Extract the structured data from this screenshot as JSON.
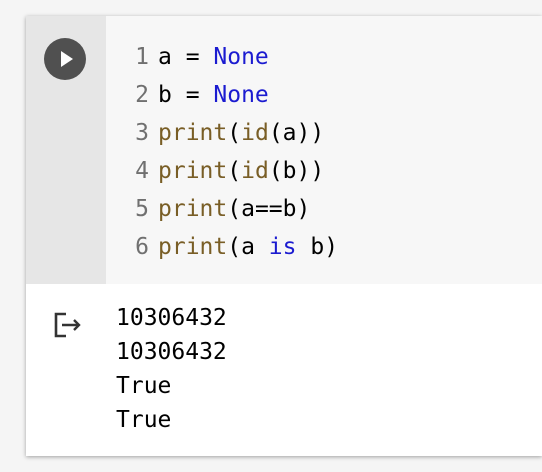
{
  "cell": {
    "code_lines": [
      {
        "num": "1",
        "parts": [
          {
            "t": "a = ",
            "c": "plain"
          },
          {
            "t": "None",
            "c": "kw"
          }
        ]
      },
      {
        "num": "2",
        "parts": [
          {
            "t": "b = ",
            "c": "plain"
          },
          {
            "t": "None",
            "c": "kw"
          }
        ]
      },
      {
        "num": "3",
        "parts": [
          {
            "t": "print",
            "c": "fn"
          },
          {
            "t": "(",
            "c": "plain"
          },
          {
            "t": "id",
            "c": "fn"
          },
          {
            "t": "(a))",
            "c": "plain"
          }
        ]
      },
      {
        "num": "4",
        "parts": [
          {
            "t": "print",
            "c": "fn"
          },
          {
            "t": "(",
            "c": "plain"
          },
          {
            "t": "id",
            "c": "fn"
          },
          {
            "t": "(b))",
            "c": "plain"
          }
        ]
      },
      {
        "num": "5",
        "parts": [
          {
            "t": "print",
            "c": "fn"
          },
          {
            "t": "(a==b)",
            "c": "plain"
          }
        ]
      },
      {
        "num": "6",
        "parts": [
          {
            "t": "print",
            "c": "fn"
          },
          {
            "t": "(a ",
            "c": "plain"
          },
          {
            "t": "is",
            "c": "kw"
          },
          {
            "t": " b)",
            "c": "plain"
          }
        ]
      }
    ],
    "run_button_icon": "play-icon",
    "output_icon": "output-arrow-icon",
    "output_lines": [
      "10306432",
      "10306432",
      "True",
      "True"
    ]
  },
  "colors": {
    "keyword": "#1b1bd0",
    "function": "#795e26",
    "gutter": "#e6e6e6",
    "editor_bg": "#f7f7f7"
  }
}
